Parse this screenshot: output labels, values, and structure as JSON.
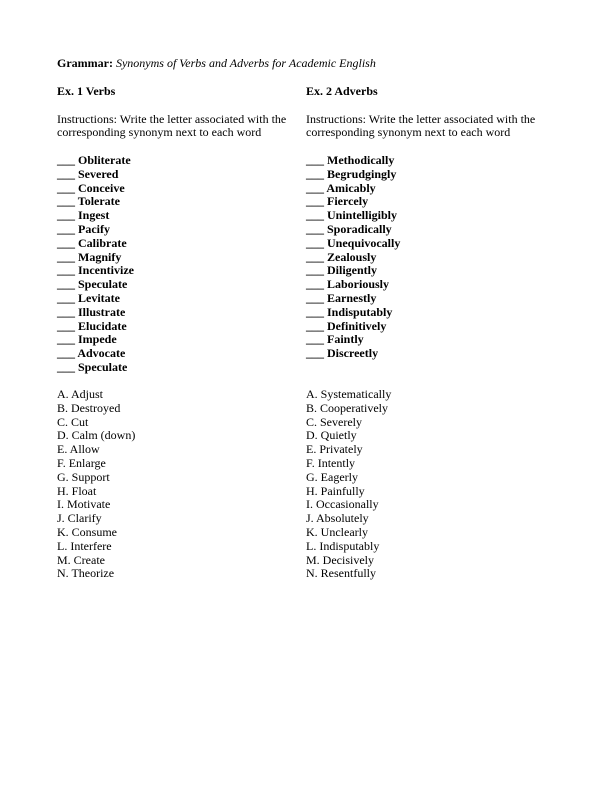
{
  "title": {
    "label": "Grammar:",
    "subtitle": "Synonyms of Verbs and Adverbs for Academic English"
  },
  "exercises": [
    {
      "heading": "Ex. 1 Verbs",
      "instructions": "Instructions: Write the letter associated with the corresponding synonym next to each word",
      "blank": "___",
      "words": [
        "Obliterate",
        "Severed",
        "Conceive",
        "Tolerate",
        "Ingest",
        "Pacify",
        "Calibrate",
        "Magnify",
        "Incentivize",
        "Speculate",
        "Levitate",
        "Illustrate",
        "Elucidate",
        "Impede",
        "Advocate",
        "Speculate"
      ],
      "options": [
        "A. Adjust",
        "B. Destroyed",
        "C. Cut",
        "D. Calm (down)",
        "E. Allow",
        "F. Enlarge",
        "G. Support",
        "H. Float",
        "I. Motivate",
        "J. Clarify",
        "K. Consume",
        "L. Interfere",
        "M. Create",
        "N. Theorize"
      ]
    },
    {
      "heading": "Ex. 2 Adverbs",
      "instructions": "Instructions: Write the letter associated with the corresponding synonym next to each word",
      "blank": "___",
      "words": [
        "Methodically",
        "Begrudgingly",
        "Amicably",
        "Fiercely",
        "Unintelligibly",
        "Sporadically",
        "Unequivocally",
        "Zealously",
        "Diligently",
        "Laboriously",
        "Earnestly",
        "Indisputably",
        "Definitively",
        "Faintly",
        "Discreetly"
      ],
      "options": [
        "A. Systematically",
        "B. Cooperatively",
        "C. Severely",
        "D. Quietly",
        "E. Privately",
        "F. Intently",
        "G. Eagerly",
        "H. Painfully",
        "I. Occasionally",
        "J. Absolutely",
        "K. Unclearly",
        "L. Indisputably",
        "M. Decisively",
        "N. Resentfully"
      ]
    }
  ]
}
